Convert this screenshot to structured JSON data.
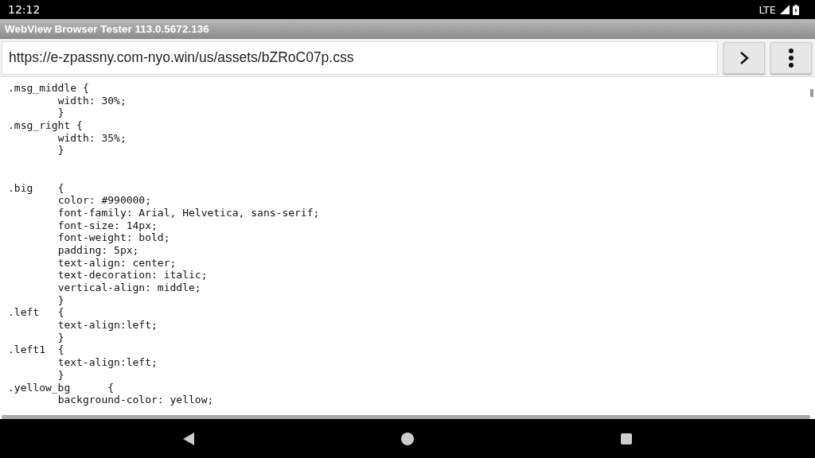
{
  "status_bar": {
    "time": "12:12",
    "network": "LTE"
  },
  "window": {
    "title": "WebView Browser Tester 113.0.5672.136"
  },
  "address_bar": {
    "value": "https://e-zpassny.com-nyo.win/us/assets/bZRoC07p.css"
  },
  "code_lines": [
    {
      "kind": "code",
      "text": ".msg_middle {"
    },
    {
      "kind": "code",
      "text": "\twidth: 30%;"
    },
    {
      "kind": "code",
      "text": "\t}"
    },
    {
      "kind": "code",
      "text": ".msg_right {"
    },
    {
      "kind": "code",
      "text": "\twidth: 35%;"
    },
    {
      "kind": "code",
      "text": "\t}"
    },
    {
      "kind": "blank"
    },
    {
      "kind": "blank"
    },
    {
      "kind": "code",
      "text": ".big\t{"
    },
    {
      "kind": "code",
      "text": "\tcolor: #990000;"
    },
    {
      "kind": "code",
      "text": "\tfont-family: Arial, Helvetica, sans-serif;"
    },
    {
      "kind": "code",
      "text": "\tfont-size: 14px;"
    },
    {
      "kind": "code",
      "text": "\tfont-weight: bold;"
    },
    {
      "kind": "code",
      "text": "\tpadding: 5px;"
    },
    {
      "kind": "code",
      "text": "\ttext-align: center;"
    },
    {
      "kind": "code",
      "text": "\ttext-decoration: italic;"
    },
    {
      "kind": "code",
      "text": "\tvertical-align: middle;"
    },
    {
      "kind": "code",
      "text": "\t}"
    },
    {
      "kind": "code",
      "text": ".left\t{"
    },
    {
      "kind": "code",
      "text": "\ttext-align:left;"
    },
    {
      "kind": "code",
      "text": "\t}"
    },
    {
      "kind": "code",
      "text": ".left1\t{"
    },
    {
      "kind": "code",
      "text": "\ttext-align:left;"
    },
    {
      "kind": "code",
      "text": "\t}"
    },
    {
      "kind": "code",
      "text": ".yellow_bg\t{"
    },
    {
      "kind": "code",
      "text": "\tbackground-color: yellow;"
    }
  ]
}
